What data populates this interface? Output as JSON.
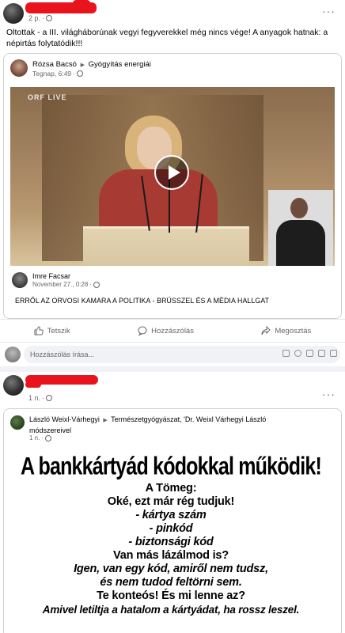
{
  "post1": {
    "time": "2 p.",
    "text": "Oltottak - a III. világháborúnak vegyi fegyverekkel még nincs vége! A anyagok hatnak: a népirtás folytatódik!!!",
    "more": "···",
    "shared": {
      "author": "Rózsa Bacsó",
      "group": "Gyógyítás energiái",
      "time": "Tegnap, 6:49",
      "video_overlay": "ORF LIVE",
      "inner_author": "Imre Facsar",
      "inner_time": "November 27., 0:28",
      "inner_text": "ERRŐL AZ ORVOSI KAMARA A POLITIKA - BRÜSSZEL ÉS A MÉDIA HALLGAT"
    },
    "actions": {
      "like": "Tetszik",
      "comment": "Hozzászólás",
      "share": "Megosztás"
    },
    "comment_placeholder": "Hozzászólás írása..."
  },
  "post2": {
    "time": "1 n.",
    "more": "···",
    "shared": {
      "author": "László Weixl-Várhegyi",
      "group": "Természetgyógyászat, 'Dr. Weixl Várhegyi László módszereivel",
      "time": "1 n."
    },
    "meme": {
      "title": "A bankkártyád kódokkal működik!",
      "lines": [
        "A Tömeg:",
        "Oké, ezt már rég tudjuk!",
        "- kártya szám",
        "- pinkód",
        "- biztonsági kód",
        "Van más lázálmod is?",
        "Igen, van egy kód, amiről nem tudsz,",
        "és nem tudod feltörni sem.",
        "Te konteós! És mi lenne az?",
        "Amivel letiltja a hatalom a kártyádat, ha rossz leszel."
      ]
    }
  },
  "colors": {
    "redaction": "#e8131d",
    "meta_gray": "#65676b",
    "feed_bg": "#f0f2f5"
  }
}
